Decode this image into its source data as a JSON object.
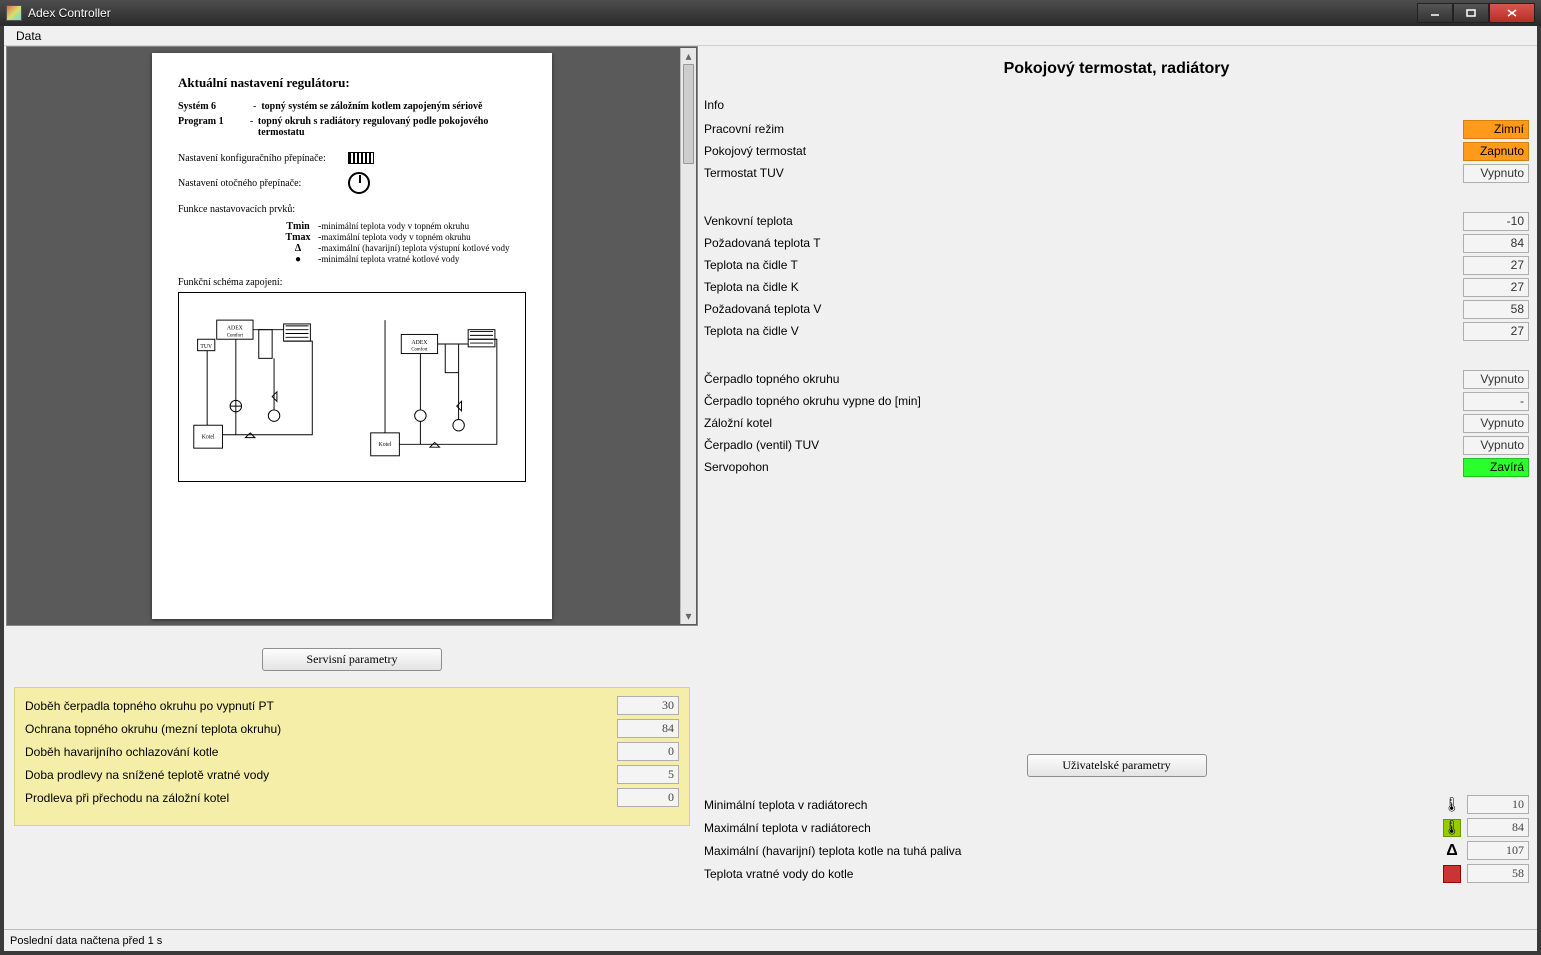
{
  "window": {
    "title": "Adex Controller"
  },
  "menu": {
    "data": "Data"
  },
  "document": {
    "heading": "Aktuální nastavení regulátoru:",
    "system_label": "Systém 6",
    "system_desc": "topný systém se záložním kotlem zapojeným sériově",
    "program_label": "Program 1",
    "program_desc": "topný okruh s radiátory regulovaný podle pokojového termostatu",
    "cfg1": "Nastavení konfiguračního přepínače:",
    "cfg2": "Nastavení otočného přepínače:",
    "func_title": "Funkce nastavovacích prvků:",
    "func": [
      {
        "k": "Tmin",
        "d": "minimální teplota vody v topném okruhu"
      },
      {
        "k": "Tmax",
        "d": "maximální teplota vody v topném okruhu"
      },
      {
        "k": "Δ",
        "d": "maximální (havarijní) teplota výstupní kotlové vody"
      },
      {
        "k": "●",
        "d": "minimální teplota vratné kotlové vody"
      }
    ],
    "schema_title": "Funkční schéma zapojení:"
  },
  "right": {
    "title": "Pokojový termostat, radiátory",
    "info_label": "Info",
    "groups": {
      "a": [
        {
          "label": "Pracovní režim",
          "value": "Zimní",
          "style": "orange"
        },
        {
          "label": "Pokojový termostat",
          "value": "Zapnuto",
          "style": "orange"
        },
        {
          "label": "Termostat TUV",
          "value": "Vypnuto",
          "style": ""
        }
      ],
      "b": [
        {
          "label": "Venkovní teplota",
          "value": "-10"
        },
        {
          "label": "Požadovaná teplota T",
          "value": "84"
        },
        {
          "label": "Teplota na čidle T",
          "value": "27"
        },
        {
          "label": "Teplota na čidle K",
          "value": "27"
        },
        {
          "label": "Požadovaná teplota V",
          "value": "58"
        },
        {
          "label": "Teplota na čidle V",
          "value": "27"
        }
      ],
      "c": [
        {
          "label": "Čerpadlo topného okruhu",
          "value": "Vypnuto",
          "style": ""
        },
        {
          "label": "Čerpadlo topného okruhu vypne do [min]",
          "value": "-",
          "style": ""
        },
        {
          "label": "Záložní kotel",
          "value": "Vypnuto",
          "style": ""
        },
        {
          "label": "Čerpadlo (ventil) TUV",
          "value": "Vypnuto",
          "style": ""
        },
        {
          "label": "Servopohon",
          "value": "Zavírá",
          "style": "green"
        }
      ]
    }
  },
  "buttons": {
    "service": "Servisní parametry",
    "user": "Uživatelské parametry"
  },
  "service_params": [
    {
      "label": "Doběh čerpadla topného okruhu po vypnutí PT",
      "value": "30"
    },
    {
      "label": "Ochrana topného okruhu (mezní teplota okruhu)",
      "value": "84"
    },
    {
      "label": "Doběh havarijního ochlazování kotle",
      "value": "0"
    },
    {
      "label": "Doba prodlevy na snížené teplotě vratné vody",
      "value": "5"
    },
    {
      "label": "Prodleva při přechodu na záložní kotel",
      "value": "0"
    }
  ],
  "user_params": [
    {
      "label": "Minimální teplota v radiátorech",
      "icon": "thermo-min",
      "value": "10"
    },
    {
      "label": "Maximální teplota v radiátorech",
      "icon": "thermo-max",
      "value": "84"
    },
    {
      "label": "Maximální (havarijní) teplota kotle na tuhá paliva",
      "icon": "delta",
      "value": "107"
    },
    {
      "label": "Teplota vratné vody do kotle",
      "icon": "return",
      "value": "58"
    }
  ],
  "status": "Poslední data načtena před 1 s"
}
